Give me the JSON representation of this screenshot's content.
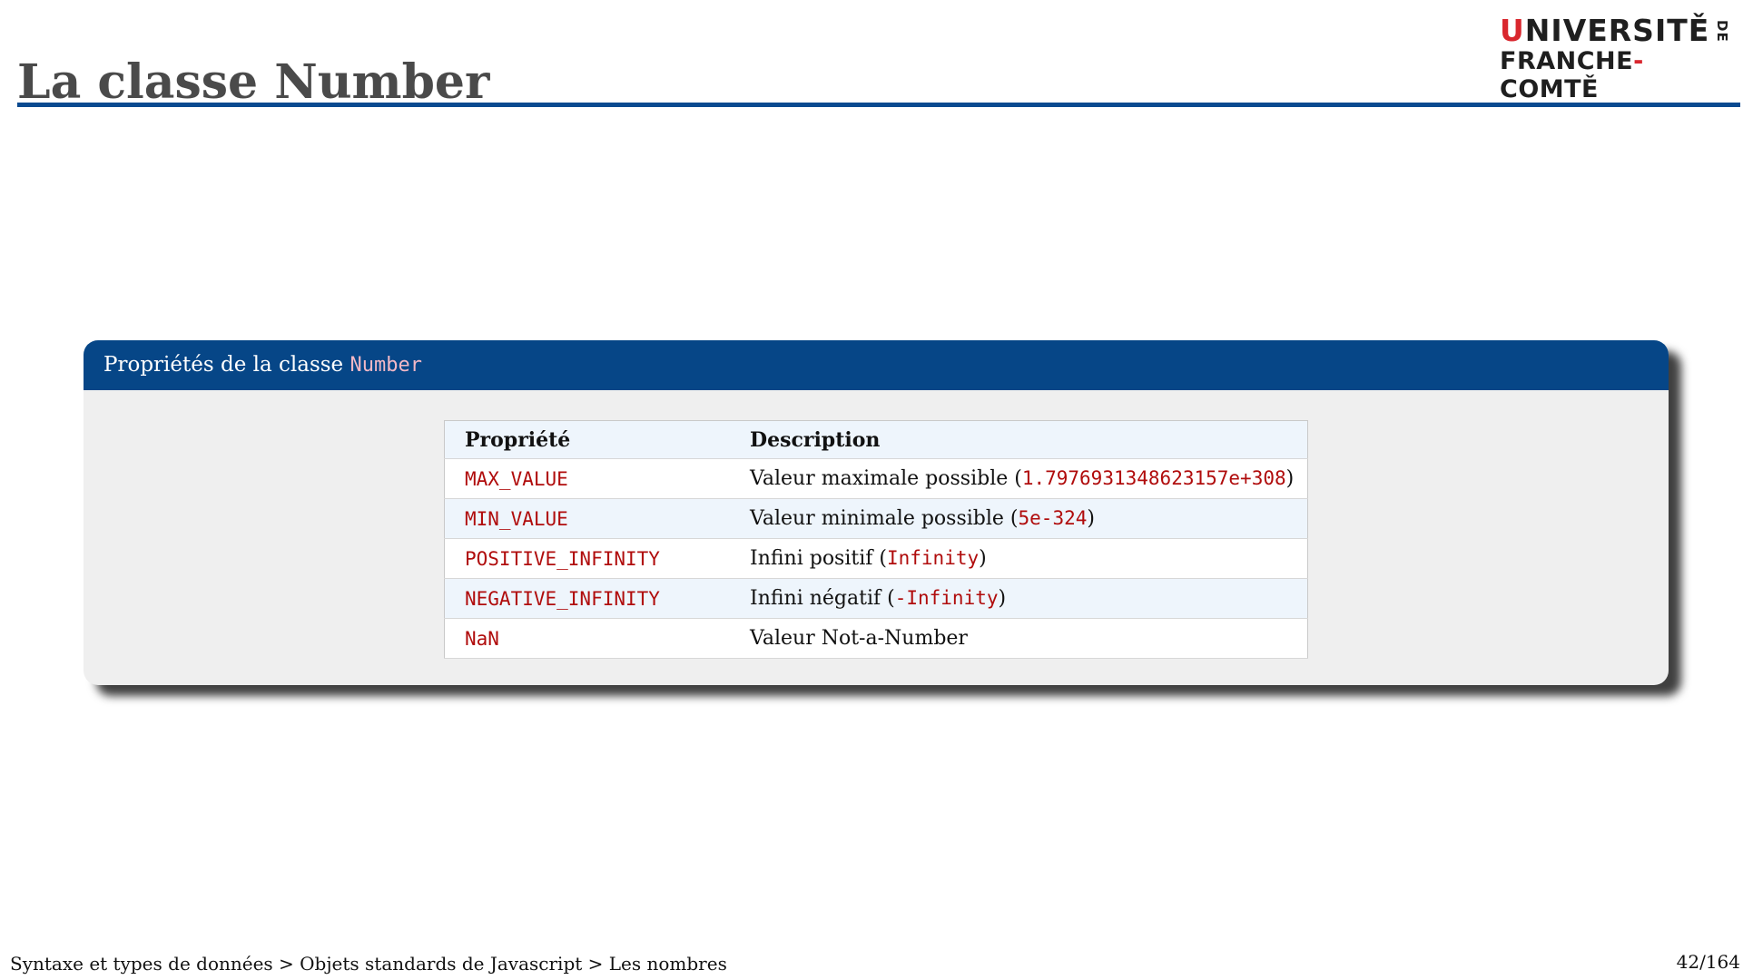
{
  "slide": {
    "title": "La classe Number"
  },
  "logo": {
    "line1_pre": "",
    "line1_accent": "U",
    "line1_rest": "NIVERSITĚ",
    "line2_pre": "FRANCHE",
    "line2_accent": "-",
    "line2_rest": "COMTĚ",
    "de": "DE",
    "accent_color": "#d9272e"
  },
  "block": {
    "header_text": "Propriétés de la classe ",
    "header_code": "Number",
    "header_color": "#064687"
  },
  "table": {
    "headers": [
      "Propriété",
      "Description"
    ],
    "rows": [
      {
        "property": "MAX_VALUE",
        "desc_pre": "Valeur maximale possible (",
        "desc_code": "1.7976931348623157e+308",
        "desc_post": ")"
      },
      {
        "property": "MIN_VALUE",
        "desc_pre": "Valeur minimale possible (",
        "desc_code": "5e-324",
        "desc_post": ")"
      },
      {
        "property": "POSITIVE_INFINITY",
        "desc_pre": "Infini positif (",
        "desc_code": "Infinity",
        "desc_post": ")"
      },
      {
        "property": "NEGATIVE_INFINITY",
        "desc_pre": "Infini négatif (",
        "desc_code": "-Infinity",
        "desc_post": ")"
      },
      {
        "property": "NaN",
        "desc_pre": "Valeur Not-a-Number",
        "desc_code": "",
        "desc_post": ""
      }
    ]
  },
  "footer": {
    "breadcrumb": "Syntaxe et types de données > Objets standards de Javascript > Les nombres",
    "page": "42/164"
  }
}
